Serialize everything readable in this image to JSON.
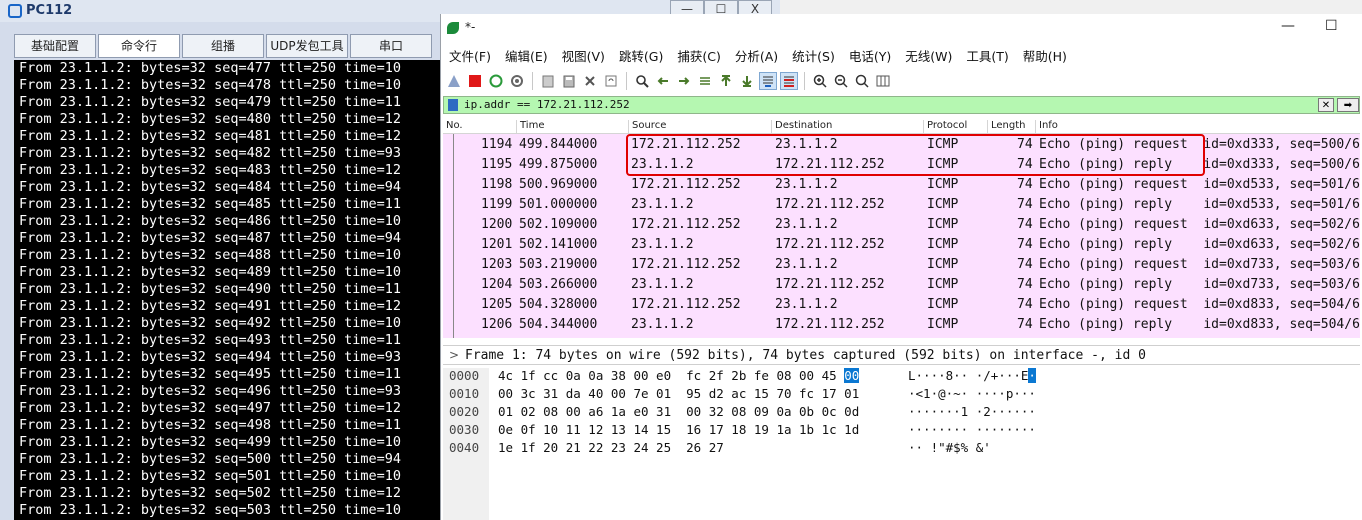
{
  "pc": {
    "title": "PC112",
    "controls": [
      "—",
      "☐",
      "X"
    ],
    "tabs": [
      "基础配置",
      "命令行",
      "组播",
      "UDP发包工具",
      "串口"
    ],
    "terminal_lines": [
      "From 23.1.1.2: bytes=32 seq=477 ttl=250 time=10",
      "From 23.1.1.2: bytes=32 seq=478 ttl=250 time=10",
      "From 23.1.1.2: bytes=32 seq=479 ttl=250 time=11",
      "From 23.1.1.2: bytes=32 seq=480 ttl=250 time=12",
      "From 23.1.1.2: bytes=32 seq=481 ttl=250 time=12",
      "From 23.1.1.2: bytes=32 seq=482 ttl=250 time=93",
      "From 23.1.1.2: bytes=32 seq=483 ttl=250 time=12",
      "From 23.1.1.2: bytes=32 seq=484 ttl=250 time=94",
      "From 23.1.1.2: bytes=32 seq=485 ttl=250 time=11",
      "From 23.1.1.2: bytes=32 seq=486 ttl=250 time=10",
      "From 23.1.1.2: bytes=32 seq=487 ttl=250 time=94",
      "From 23.1.1.2: bytes=32 seq=488 ttl=250 time=10",
      "From 23.1.1.2: bytes=32 seq=489 ttl=250 time=10",
      "From 23.1.1.2: bytes=32 seq=490 ttl=250 time=11",
      "From 23.1.1.2: bytes=32 seq=491 ttl=250 time=12",
      "From 23.1.1.2: bytes=32 seq=492 ttl=250 time=10",
      "From 23.1.1.2: bytes=32 seq=493 ttl=250 time=11",
      "From 23.1.1.2: bytes=32 seq=494 ttl=250 time=93",
      "From 23.1.1.2: bytes=32 seq=495 ttl=250 time=11",
      "From 23.1.1.2: bytes=32 seq=496 ttl=250 time=93",
      "From 23.1.1.2: bytes=32 seq=497 ttl=250 time=12",
      "From 23.1.1.2: bytes=32 seq=498 ttl=250 time=11",
      "From 23.1.1.2: bytes=32 seq=499 ttl=250 time=10",
      "From 23.1.1.2: bytes=32 seq=500 ttl=250 time=94",
      "From 23.1.1.2: bytes=32 seq=501 ttl=250 time=10",
      "From 23.1.1.2: bytes=32 seq=502 ttl=250 time=12",
      "From 23.1.1.2: bytes=32 seq=503 ttl=250 time=10"
    ]
  },
  "ws": {
    "title": "*-",
    "controls": [
      "—",
      "☐"
    ],
    "menu": [
      "文件(F)",
      "编辑(E)",
      "视图(V)",
      "跳转(G)",
      "捕获(C)",
      "分析(A)",
      "统计(S)",
      "电话(Y)",
      "无线(W)",
      "工具(T)",
      "帮助(H)"
    ],
    "filter": "ip.addr == 172.21.112.252",
    "columns": [
      "No.",
      "Time",
      "Source",
      "Destination",
      "Protocol",
      "Length",
      "Info"
    ],
    "packets": [
      {
        "no": "1194",
        "time": "499.844000",
        "src": "172.21.112.252",
        "dst": "23.1.1.2",
        "proto": "ICMP",
        "len": "74",
        "info": "Echo (ping) request  id=0xd333, seq=500/6"
      },
      {
        "no": "1195",
        "time": "499.875000",
        "src": "23.1.1.2",
        "dst": "172.21.112.252",
        "proto": "ICMP",
        "len": "74",
        "info": "Echo (ping) reply    id=0xd333, seq=500/6"
      },
      {
        "no": "1198",
        "time": "500.969000",
        "src": "172.21.112.252",
        "dst": "23.1.1.2",
        "proto": "ICMP",
        "len": "74",
        "info": "Echo (ping) request  id=0xd533, seq=501/6"
      },
      {
        "no": "1199",
        "time": "501.000000",
        "src": "23.1.1.2",
        "dst": "172.21.112.252",
        "proto": "ICMP",
        "len": "74",
        "info": "Echo (ping) reply    id=0xd533, seq=501/6"
      },
      {
        "no": "1200",
        "time": "502.109000",
        "src": "172.21.112.252",
        "dst": "23.1.1.2",
        "proto": "ICMP",
        "len": "74",
        "info": "Echo (ping) request  id=0xd633, seq=502/6"
      },
      {
        "no": "1201",
        "time": "502.141000",
        "src": "23.1.1.2",
        "dst": "172.21.112.252",
        "proto": "ICMP",
        "len": "74",
        "info": "Echo (ping) reply    id=0xd633, seq=502/6"
      },
      {
        "no": "1203",
        "time": "503.219000",
        "src": "172.21.112.252",
        "dst": "23.1.1.2",
        "proto": "ICMP",
        "len": "74",
        "info": "Echo (ping) request  id=0xd733, seq=503/6"
      },
      {
        "no": "1204",
        "time": "503.266000",
        "src": "23.1.1.2",
        "dst": "172.21.112.252",
        "proto": "ICMP",
        "len": "74",
        "info": "Echo (ping) reply    id=0xd733, seq=503/6"
      },
      {
        "no": "1205",
        "time": "504.328000",
        "src": "172.21.112.252",
        "dst": "23.1.1.2",
        "proto": "ICMP",
        "len": "74",
        "info": "Echo (ping) request  id=0xd833, seq=504/6"
      },
      {
        "no": "1206",
        "time": "504.344000",
        "src": "23.1.1.2",
        "dst": "172.21.112.252",
        "proto": "ICMP",
        "len": "74",
        "info": "Echo (ping) reply    id=0xd833, seq=504/6"
      }
    ],
    "detail": "Frame 1: 74 bytes on wire (592 bits), 74 bytes captured (592 bits) on interface -, id 0",
    "bytes": [
      {
        "offset": "0000",
        "hex": "4c 1f cc 0a 0a 38 00 e0  fc 2f 2b fe 08 00 45 ",
        "hex_sel": "00",
        "ascii": "L····8·· ·/+···E",
        "ascii_sel": "·"
      },
      {
        "offset": "0010",
        "hex": "00 3c 31 da 40 00 7e 01  95 d2 ac 15 70 fc 17 01",
        "hex_sel": "",
        "ascii": "·<1·@·~· ····p···",
        "ascii_sel": ""
      },
      {
        "offset": "0020",
        "hex": "01 02 08 00 a6 1a e0 31  00 32 08 09 0a 0b 0c 0d",
        "hex_sel": "",
        "ascii": "·······1 ·2······",
        "ascii_sel": ""
      },
      {
        "offset": "0030",
        "hex": "0e 0f 10 11 12 13 14 15  16 17 18 19 1a 1b 1c 1d",
        "hex_sel": "",
        "ascii": "········ ········",
        "ascii_sel": ""
      },
      {
        "offset": "0040",
        "hex": "1e 1f 20 21 22 23 24 25  26 27",
        "hex_sel": "",
        "ascii": "·· !\"#$% &'",
        "ascii_sel": ""
      }
    ]
  }
}
